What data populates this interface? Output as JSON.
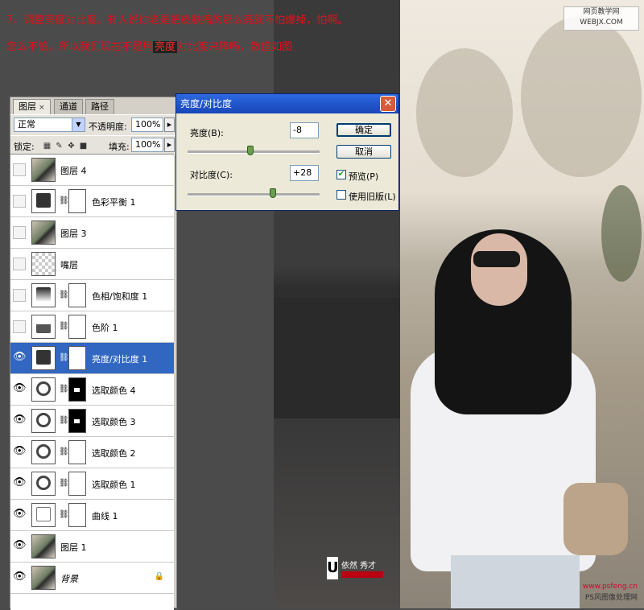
{
  "caption": {
    "line1": "7、调整亮度对比度。有人说你老是把皮肤搞的那么亮就不怕爆掉，怕啊。",
    "line2_before": "怎么不怕，所以我们现在不是用",
    "line2_highlight": "亮度",
    "line2_after": "对比度来降吗，数值如图"
  },
  "watermarks": {
    "top_site_name": "网页教学网",
    "top_site_url": "WEBJX.COM",
    "bottom_url": "www.psfeng.cn",
    "bottom_name": "PS风图像处理网",
    "logo_letter": "U",
    "logo_text": "依然 秀才"
  },
  "layers_panel": {
    "tabs": [
      {
        "label": "图层",
        "close": "×"
      },
      {
        "label": "通道"
      },
      {
        "label": "路径"
      }
    ],
    "blend_mode": "正常",
    "opacity_label": "不透明度:",
    "opacity_value": "100%",
    "lock_label": "锁定:",
    "fill_label": "填充:",
    "fill_value": "100%",
    "layers": [
      {
        "name": "图层 4",
        "visible": false,
        "thumb": "img"
      },
      {
        "name": "色彩平衡 1",
        "visible": false,
        "thumb": "adj",
        "mask": "white"
      },
      {
        "name": "图层 3",
        "visible": false,
        "thumb": "img"
      },
      {
        "name": "嘴层",
        "visible": false,
        "thumb": "empty"
      },
      {
        "name": "色相/饱和度 1",
        "visible": false,
        "thumb": "grad",
        "mask": "white"
      },
      {
        "name": "色阶 1",
        "visible": false,
        "thumb": "hist",
        "mask": "white"
      },
      {
        "name": "亮度/对比度 1",
        "visible": true,
        "thumb": "adj",
        "mask": "white",
        "selected": true
      },
      {
        "name": "选取颜色 4",
        "visible": true,
        "thumb": "circ",
        "mask": "black"
      },
      {
        "name": "选取颜色 3",
        "visible": true,
        "thumb": "circ",
        "mask": "black"
      },
      {
        "name": "选取颜色 2",
        "visible": true,
        "thumb": "circ",
        "mask": "white"
      },
      {
        "name": "选取颜色 1",
        "visible": true,
        "thumb": "circ",
        "mask": "white"
      },
      {
        "name": "曲线 1",
        "visible": true,
        "thumb": "curve",
        "mask": "white"
      },
      {
        "name": "图层 1",
        "visible": true,
        "thumb": "img"
      },
      {
        "name": "背景",
        "visible": true,
        "thumb": "img",
        "locked": true
      }
    ]
  },
  "dialog": {
    "title": "亮度/对比度",
    "brightness_label": "亮度(B):",
    "brightness_value": "-8",
    "contrast_label": "对比度(C):",
    "contrast_value": "+28",
    "ok_label": "确定",
    "cancel_label": "取消",
    "preview_label": "预览(P)",
    "preview_checked": true,
    "legacy_label": "使用旧版(L)",
    "legacy_checked": false
  }
}
